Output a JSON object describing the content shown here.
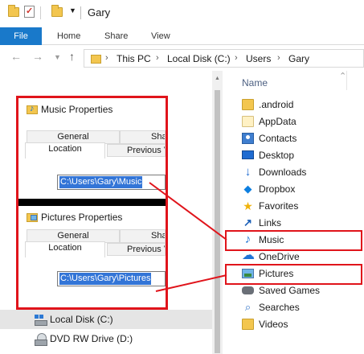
{
  "window": {
    "title": "Gary"
  },
  "ribbon": {
    "tabs": [
      "File",
      "Home",
      "Share",
      "View"
    ]
  },
  "address": {
    "crumbs": [
      "This PC",
      "Local Disk (C:)",
      "Users",
      "Gary"
    ]
  },
  "nav_pane": {
    "items": [
      {
        "label": "Local Disk (C:)",
        "selected": true,
        "icon": "local-disk-icon"
      },
      {
        "label": "DVD RW Drive (D:)",
        "selected": false,
        "icon": "dvd-drive-icon"
      }
    ]
  },
  "file_list": {
    "column_header": "Name",
    "items": [
      {
        "label": ".android",
        "icon": "folder-icon"
      },
      {
        "label": "AppData",
        "icon": "folder-icon"
      },
      {
        "label": "Contacts",
        "icon": "contacts-icon"
      },
      {
        "label": "Desktop",
        "icon": "desktop-icon"
      },
      {
        "label": "Downloads",
        "icon": "downloads-icon"
      },
      {
        "label": "Dropbox",
        "icon": "dropbox-icon"
      },
      {
        "label": "Favorites",
        "icon": "star-icon"
      },
      {
        "label": "Links",
        "icon": "links-icon"
      },
      {
        "label": "Music",
        "icon": "music-icon"
      },
      {
        "label": "OneDrive",
        "icon": "onedrive-icon"
      },
      {
        "label": "Pictures",
        "icon": "pictures-icon"
      },
      {
        "label": "Saved Games",
        "icon": "saved-games-icon"
      },
      {
        "label": "Searches",
        "icon": "search-icon"
      },
      {
        "label": "Videos",
        "icon": "folder-icon"
      }
    ]
  },
  "music_dialog": {
    "title": "Music Properties",
    "tabs_row1": [
      "General",
      "Shar"
    ],
    "tabs_row2": [
      "Location",
      "Previous V"
    ],
    "path": "C:\\Users\\Gary\\Music"
  },
  "pictures_dialog": {
    "title": "Pictures Properties",
    "tabs_row1": [
      "General",
      "Shar"
    ],
    "tabs_row2": [
      "Location",
      "Previous V"
    ],
    "path": "C:\\Users\\Gary\\Pictures"
  },
  "colors": {
    "annotation": "#e0141b",
    "accent": "#1979ca",
    "selection": "#3375d7"
  }
}
